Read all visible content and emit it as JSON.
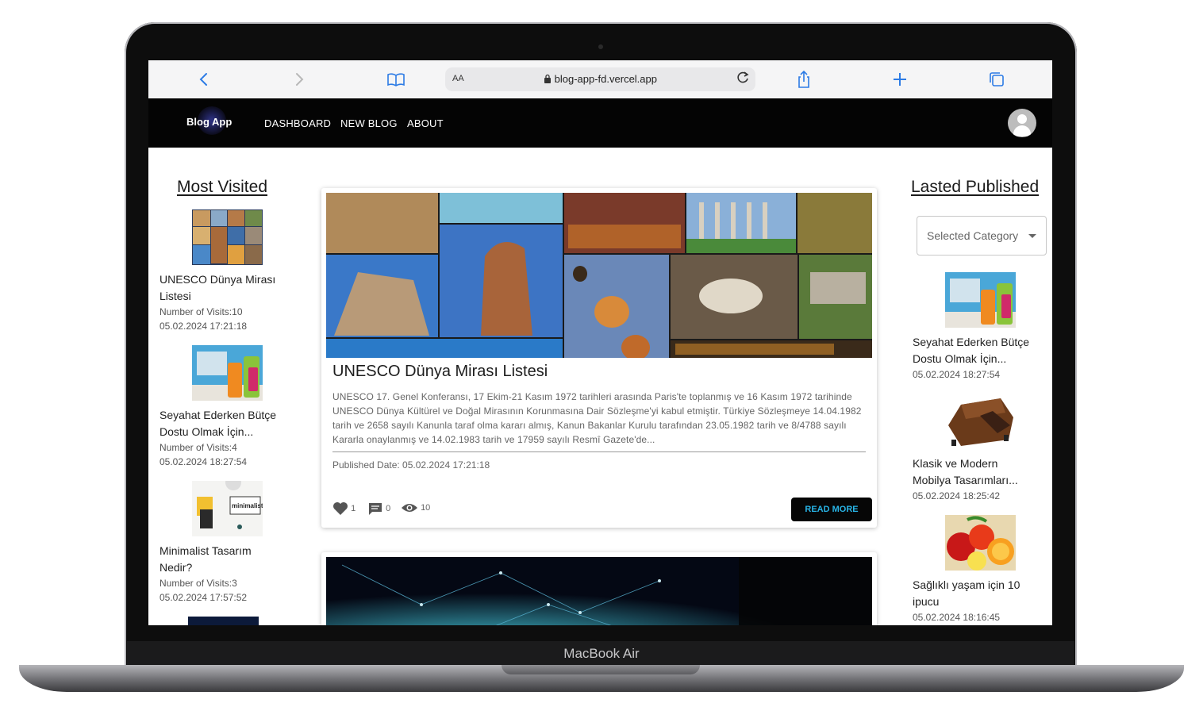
{
  "device": {
    "label": "MacBook Air"
  },
  "browser": {
    "reader_label": "AA",
    "url": "blog-app-fd.vercel.app"
  },
  "nav": {
    "logo": "Blog App",
    "links": [
      "DASHBOARD",
      "NEW BLOG",
      "ABOUT"
    ]
  },
  "most_visited": {
    "title": "Most Visited",
    "items": [
      {
        "title_line1": "UNESCO Dünya Mirası",
        "title_line2": "Listesi",
        "visits": "Number of Visits:10",
        "date": "05.02.2024 17:21:18",
        "thumb": "collage"
      },
      {
        "title_line1": "Seyahat Ederken Bütçe",
        "title_line2": "Dostu Olmak İçin...",
        "visits": "Number of Visits:4",
        "date": "05.02.2024 18:27:54",
        "thumb": "luggage"
      },
      {
        "title_line1": "Minimalist Tasarım",
        "title_line2": "Nedir?",
        "visits": "Number of Visits:3",
        "date": "05.02.2024 17:57:52",
        "thumb": "minimalist"
      }
    ]
  },
  "latest": {
    "title": "Lasted Published",
    "select_placeholder": "Selected Category",
    "items": [
      {
        "title_line1": "Seyahat Ederken Bütçe",
        "title_line2": "Dostu Olmak İçin...",
        "date": "05.02.2024 18:27:54",
        "thumb": "luggage"
      },
      {
        "title_line1": "Klasik ve Modern",
        "title_line2": "Mobilya Tasarımları...",
        "date": "05.02.2024 18:25:42",
        "thumb": "sofa"
      },
      {
        "title_line1": "Sağlıklı yaşam için 10",
        "title_line2": "ipucu",
        "date": "05.02.2024 18:16:45",
        "thumb": "fruits"
      }
    ]
  },
  "featured": {
    "title": "UNESCO Dünya Mirası Listesi",
    "description": "UNESCO 17. Genel Konferansı, 17 Ekim-21 Kasım 1972 tarihleri arasında Paris'te toplanmış ve 16 Kasım 1972 tarihinde UNESCO Dünya Kültürel ve Doğal Mirasının Korunmasına Dair Sözleşme'yi kabul etmiştir. Türkiye Sözleşmeye 14.04.1982 tarih ve 2658 sayılı Kanunla taraf olma kararı almış, Kanun Bakanlar Kurulu tarafından 23.05.1982 tarih ve 8/4788 sayılı Kararla onaylanmış ve 14.02.1983 tarih ve 17959 sayılı Resmî Gazete'de...",
    "published": "Published Date: 05.02.2024 17:21:18",
    "likes": "1",
    "comments": "0",
    "views": "10",
    "read_more": "READ MORE"
  },
  "colors": {
    "accent": "#28b4e6",
    "nav_bg": "#040404",
    "browser_blue": "#2c7be5"
  }
}
